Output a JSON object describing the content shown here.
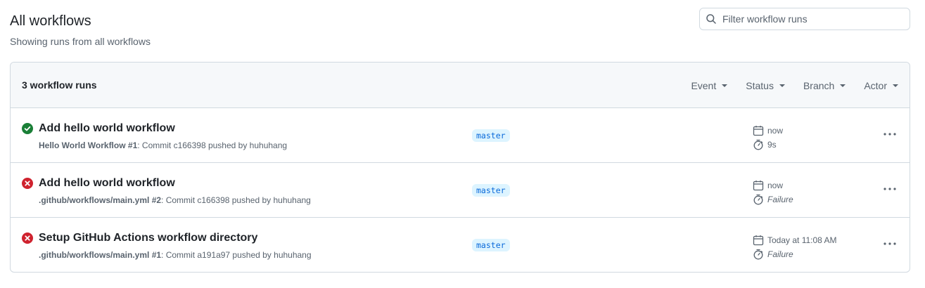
{
  "header": {
    "title": "All workflows",
    "subtitle": "Showing runs from all workflows"
  },
  "search": {
    "placeholder": "Filter workflow runs",
    "value": ""
  },
  "runs_list": {
    "count_label": "3 workflow runs",
    "filters": [
      {
        "label": "Event"
      },
      {
        "label": "Status"
      },
      {
        "label": "Branch"
      },
      {
        "label": "Actor"
      }
    ],
    "runs": [
      {
        "status": "success",
        "title": "Add hello world workflow",
        "workflow": "Hello World Workflow",
        "run_number": " #1",
        "detail": ": Commit c166398 pushed by huhuhang",
        "branch": "master",
        "time": "now",
        "duration": "9s"
      },
      {
        "status": "failure",
        "title": "Add hello world workflow",
        "workflow": ".github/workflows/main.yml",
        "run_number": " #2",
        "detail": ": Commit c166398 pushed by huhuhang",
        "branch": "master",
        "time": "now",
        "duration": "Failure"
      },
      {
        "status": "failure",
        "title": "Setup GitHub Actions workflow directory",
        "workflow": ".github/workflows/main.yml",
        "run_number": " #1",
        "detail": ": Commit a191a97 pushed by huhuhang",
        "branch": "master",
        "time": "Today at 11:08 AM",
        "duration": "Failure"
      }
    ]
  },
  "colors": {
    "success": "#1a7f37",
    "failure": "#cf222e",
    "branch_bg": "#ddf4ff",
    "branch_fg": "#0969da",
    "muted": "#59636e",
    "border": "#d1d9e0"
  }
}
